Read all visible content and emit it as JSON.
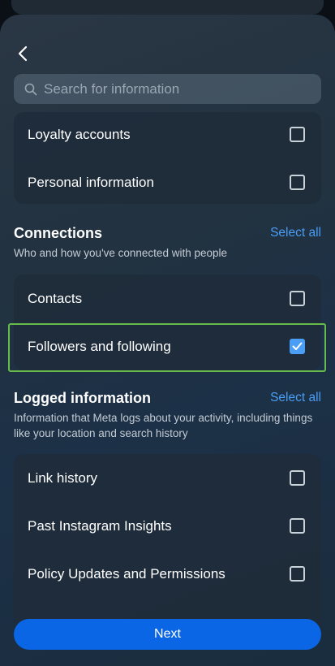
{
  "header": {
    "back_icon": "chevron-left-icon"
  },
  "search": {
    "placeholder": "Search for information",
    "icon": "search-icon"
  },
  "card_top": {
    "items": [
      {
        "label": "Loyalty accounts",
        "checked": false
      },
      {
        "label": "Personal information",
        "checked": false
      }
    ]
  },
  "connections": {
    "title": "Connections",
    "select_all": "Select all",
    "description": "Who and how you've connected with people",
    "items": [
      {
        "label": "Contacts",
        "checked": false
      },
      {
        "label": "Followers and following",
        "checked": true
      }
    ]
  },
  "logged": {
    "title": "Logged information",
    "select_all": "Select all",
    "description": "Information that Meta logs about your activity, including things like your location and search history",
    "items": [
      {
        "label": "Link history",
        "checked": false
      },
      {
        "label": "Past Instagram Insights",
        "checked": false
      },
      {
        "label": "Policy Updates and Permissions",
        "checked": false
      }
    ]
  },
  "footer": {
    "next_label": "Next"
  },
  "colors": {
    "accent": "#4a9ef5",
    "button": "#0a66e4",
    "highlight": "#66bb4a"
  }
}
